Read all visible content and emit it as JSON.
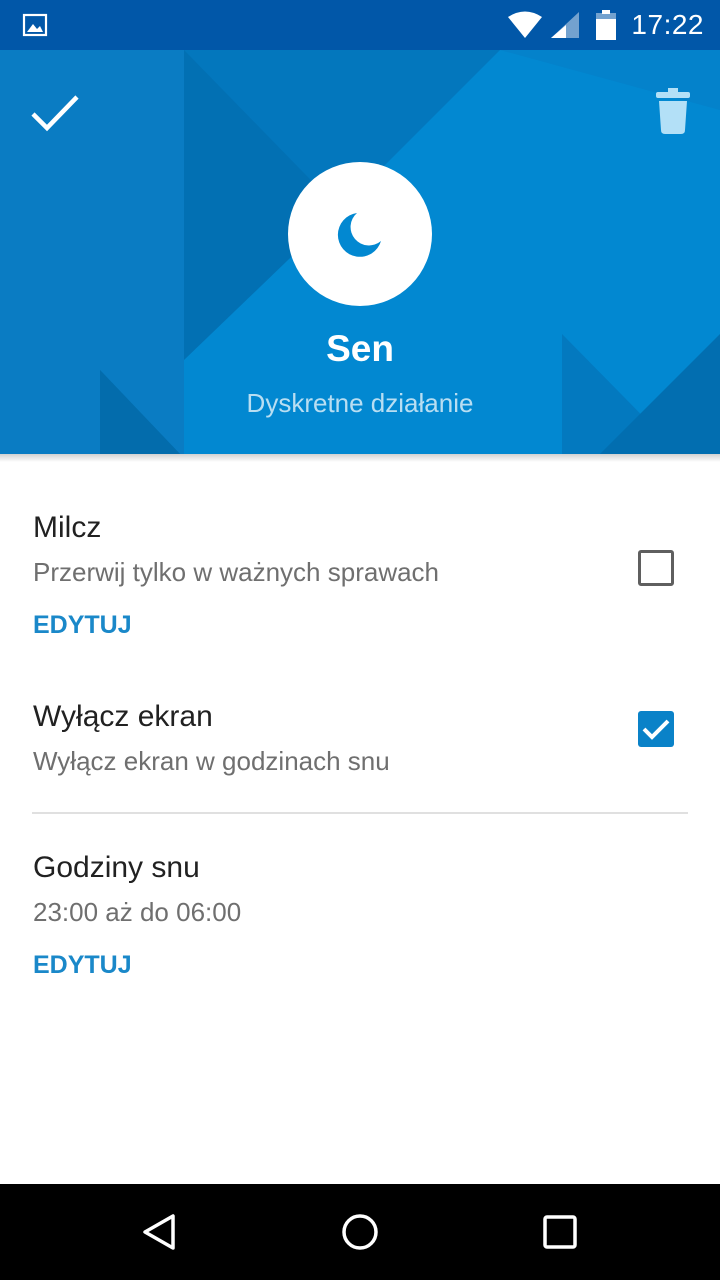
{
  "status_bar": {
    "time": "17:22",
    "icons": [
      "image-notification-icon",
      "wifi-icon",
      "signal-icon",
      "battery-icon"
    ],
    "background_color": "#0157a8"
  },
  "header": {
    "confirm_icon": "check-icon",
    "delete_icon": "trash-icon",
    "mode_icon": "moon-icon",
    "title": "Sen",
    "subtitle": "Dyskretne działanie",
    "background_color": "#0288d1"
  },
  "settings": [
    {
      "title": "Milcz",
      "description": "Przerwij tylko w ważnych sprawach",
      "action": "EDYTUJ",
      "checked": false
    },
    {
      "title": "Wyłącz ekran",
      "description": "Wyłącz ekran w godzinach snu",
      "checked": true
    },
    {
      "title": "Godziny snu",
      "description": "23:00 aż do 06:00",
      "action": "EDYTUJ"
    }
  ],
  "nav_bar": {
    "buttons": [
      "back-icon",
      "home-icon",
      "recents-icon"
    ]
  },
  "colors": {
    "accent": "#1a88c9",
    "checkbox_checked": "#0a82c8",
    "primary_text": "#212121",
    "secondary_text": "#6f6f6f"
  }
}
